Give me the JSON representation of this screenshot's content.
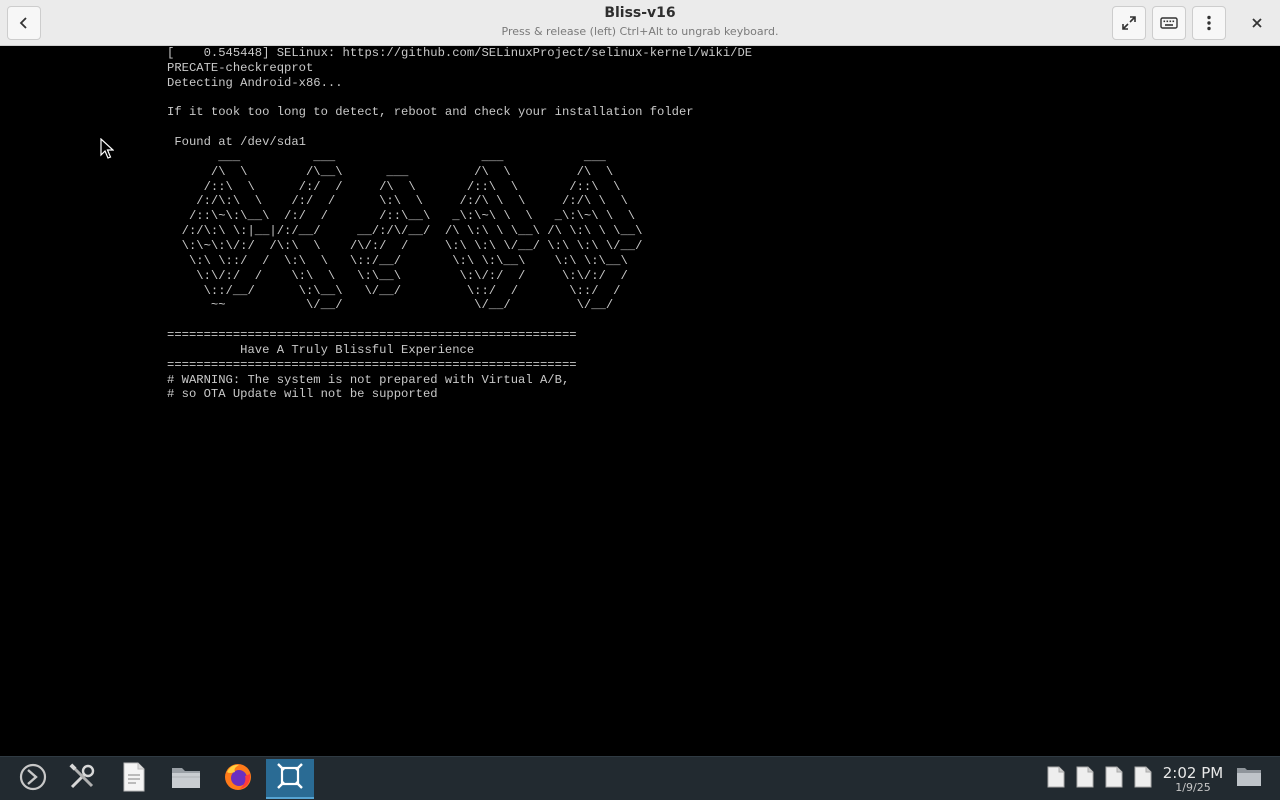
{
  "window": {
    "title": "Bliss-v16",
    "subtitle": "Press & release (left) Ctrl+Alt to ungrab keyboard."
  },
  "titlebar_icons": {
    "back": "chevron-left-icon",
    "fullscreen": "fullscreen-icon",
    "keyboard": "keyboard-icon",
    "menu": "kebab-menu-icon",
    "close": "close-icon"
  },
  "console": {
    "lines": [
      "[    0.545448] SELinux: https://github.com/SELinuxProject/selinux-kernel/wiki/DE",
      "PRECATE-checkreqprot",
      "Detecting Android-x86...",
      "",
      "If it took too long to detect, reboot and check your installation folder",
      "",
      " Found at /dev/sda1",
      "       ___          ___                    ___           ___",
      "      /\\  \\        /\\__\\      ___         /\\  \\         /\\  \\",
      "     /::\\  \\      /:/  /     /\\  \\       /::\\  \\       /::\\  \\",
      "    /:/\\:\\  \\    /:/  /      \\:\\  \\     /:/\\ \\  \\     /:/\\ \\  \\",
      "   /::\\~\\:\\__\\  /:/  /       /::\\__\\   _\\:\\~\\ \\  \\   _\\:\\~\\ \\  \\",
      "  /:/\\:\\ \\:|__|/:/__/     __/:/\\/__/  /\\ \\:\\ \\ \\__\\ /\\ \\:\\ \\ \\__\\",
      "  \\:\\~\\:\\/:/  /\\:\\  \\    /\\/:/  /     \\:\\ \\:\\ \\/__/ \\:\\ \\:\\ \\/__/",
      "   \\:\\ \\::/  /  \\:\\  \\   \\::/__/       \\:\\ \\:\\__\\    \\:\\ \\:\\__\\",
      "    \\:\\/:/  /    \\:\\  \\   \\:\\__\\        \\:\\/:/  /     \\:\\/:/  /",
      "     \\::/__/      \\:\\__\\   \\/__/         \\::/  /       \\::/  /",
      "      ~~           \\/__/                  \\/__/         \\/__/",
      "",
      "========================================================",
      "          Have A Truly Blissful Experience",
      "========================================================",
      "# WARNING: The system is not prepared with Virtual A/B,",
      "# so OTA Update will not be supported"
    ]
  },
  "taskbar": {
    "apps": [
      {
        "name": "app-launcher-icon"
      },
      {
        "name": "settings-tools-icon"
      },
      {
        "name": "text-editor-icon"
      },
      {
        "name": "file-manager-icon"
      },
      {
        "name": "firefox-icon"
      },
      {
        "name": "virtual-machine-icon",
        "active": true
      }
    ],
    "tray_docs": 4,
    "clock": {
      "time": "2:02 PM",
      "date": "1/9/25"
    }
  },
  "colors": {
    "titlebar_bg": "#ebebeb",
    "console_bg": "#000000",
    "console_text": "#c9c9c9",
    "taskbar_bg": "#222a30",
    "taskbar_active": "#2a6b94"
  }
}
